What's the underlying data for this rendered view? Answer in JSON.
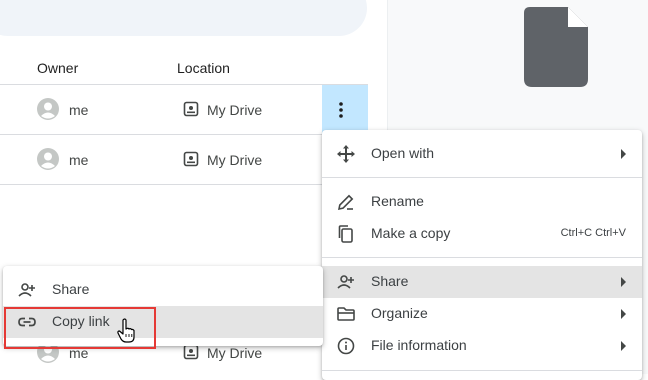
{
  "table": {
    "headers": {
      "owner": "Owner",
      "location": "Location"
    },
    "rows": [
      {
        "owner": "me",
        "location": "My Drive"
      },
      {
        "owner": "me",
        "location": "My Drive"
      },
      {
        "owner": "me",
        "location": "My Drive"
      }
    ]
  },
  "context_menu": {
    "items": [
      {
        "label": "Open with",
        "icon": "open-with-icon",
        "has_submenu": true
      },
      {
        "label": "Rename",
        "icon": "rename-icon"
      },
      {
        "label": "Make a copy",
        "icon": "copy-icon",
        "shortcut": "Ctrl+C Ctrl+V"
      },
      {
        "label": "Share",
        "icon": "share-icon",
        "has_submenu": true,
        "highlighted": true
      },
      {
        "label": "Organize",
        "icon": "folder-icon",
        "has_submenu": true
      },
      {
        "label": "File information",
        "icon": "info-icon",
        "has_submenu": true
      }
    ]
  },
  "share_submenu": {
    "items": [
      {
        "label": "Share",
        "icon": "share-icon"
      },
      {
        "label": "Copy link",
        "icon": "link-icon",
        "highlighted": true
      }
    ]
  },
  "colors": {
    "highlight": "#e4e4e4",
    "selected_row_button": "#c2e7ff",
    "callout": "#e53935",
    "icon": "#444746"
  }
}
